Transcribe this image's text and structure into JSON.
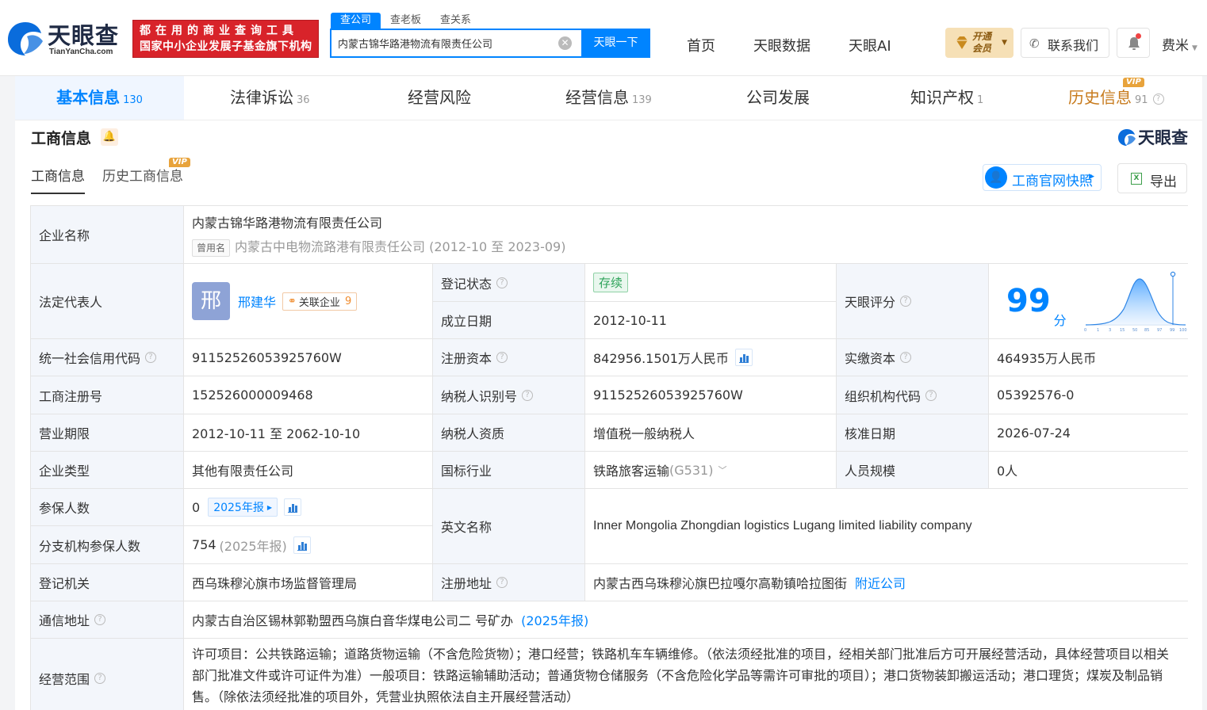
{
  "header": {
    "logo_text": "天眼查",
    "logo_sub": "TianYanCha.com",
    "slogan_line1": "都在用的商业查询工具",
    "slogan_line2": "国家中小企业发展子基金旗下机构",
    "search_tabs": [
      "查公司",
      "查老板",
      "查关系"
    ],
    "search_value": "内蒙古锦华路港物流有限责任公司",
    "search_button": "天眼一下",
    "nav": [
      "首页",
      "天眼数据",
      "天眼AI"
    ],
    "vip_line1": "开通",
    "vip_line2": "会员",
    "contact": "联系我们",
    "user": "费米"
  },
  "tabs": [
    {
      "label": "基本信息",
      "count": "130"
    },
    {
      "label": "法律诉讼",
      "count": "36"
    },
    {
      "label": "经营风险",
      "count": ""
    },
    {
      "label": "经营信息",
      "count": "139"
    },
    {
      "label": "公司发展",
      "count": ""
    },
    {
      "label": "知识产权",
      "count": "1"
    },
    {
      "label": "历史信息",
      "count": "91"
    }
  ],
  "vip_tag": "VIP",
  "section": {
    "title": "工商信息",
    "watermark": "天眼查",
    "subtabs": [
      "工商信息",
      "历史工商信息"
    ],
    "snapshot_button": "工商官网快照",
    "export_button": "导出"
  },
  "info": {
    "company_name_label": "企业名称",
    "company_name": "内蒙古锦华路港物流有限责任公司",
    "former_name_tag": "曾用名",
    "former_name": "内蒙古中电物流路港有限责任公司 (2012-10 至 2023-09)",
    "legal_rep_label": "法定代表人",
    "legal_rep_avatar": "邢",
    "legal_rep_name": "邢建华",
    "related_label": "关联企业",
    "related_count": "9",
    "reg_status_label": "登记状态",
    "reg_status": "存续",
    "founded_label": "成立日期",
    "founded": "2012-10-11",
    "score_label": "天眼评分",
    "score": "99",
    "score_unit": "分",
    "credit_code_label": "统一社会信用代码",
    "credit_code": "91152526053925760W",
    "reg_capital_label": "注册资本",
    "reg_capital": "842956.1501万人民币",
    "paid_capital_label": "实缴资本",
    "paid_capital": "464935万人民币",
    "reg_no_label": "工商注册号",
    "reg_no": "152526000009468",
    "taxpayer_id_label": "纳税人识别号",
    "taxpayer_id": "91152526053925760W",
    "org_code_label": "组织机构代码",
    "org_code": "05392576-0",
    "term_label": "营业期限",
    "term": "2012-10-11 至 2062-10-10",
    "tax_qual_label": "纳税人资质",
    "tax_qual": "增值税一般纳税人",
    "approval_label": "核准日期",
    "approval": "2026-07-24",
    "type_label": "企业类型",
    "type": "其他有限责任公司",
    "industry_label": "国标行业",
    "industry": "铁路旅客运输",
    "industry_code": "(G531)",
    "staff_label": "人员规模",
    "staff": "0人",
    "insured_label": "参保人数",
    "insured": "0",
    "insured_year": "2025年报",
    "branch_insured_label": "分支机构参保人数",
    "branch_insured": "754",
    "branch_insured_year": "(2025年报)",
    "english_label": "英文名称",
    "english": "Inner Mongolia Zhongdian logistics Lugang limited liability company",
    "authority_label": "登记机关",
    "authority": "西乌珠穆沁旗市场监督管理局",
    "address_label": "注册地址",
    "address": "内蒙古西乌珠穆沁旗巴拉嘎尔高勒镇哈拉图街",
    "nearby": "附近公司",
    "mail_label": "通信地址",
    "mail": "内蒙古自治区锡林郭勒盟西乌旗白音华煤电公司二 号矿办",
    "mail_year": "(2025年报)",
    "scope_label": "经营范围",
    "scope": "许可项目：公共铁路运输；道路货物运输（不含危险货物）；港口经营；铁路机车车辆维修。（依法须经批准的项目，经相关部门批准后方可开展经营活动，具体经营项目以相关部门批准文件或许可证件为准）一般项目：铁路运输辅助活动；普通货物仓储服务（不含危险化学品等需许可审批的项目）；港口货物装卸搬运活动；港口理货；煤炭及制品销售。（除依法须经批准的项目外，凭营业执照依法自主开展经营活动）"
  },
  "score_chart": {
    "ticks": [
      "0",
      "1",
      "3",
      "15",
      "50",
      "85",
      "97",
      "99",
      "100"
    ]
  },
  "colors": {
    "accent": "#0084ff",
    "slogan_red": "#d8232a",
    "vip_gold": "#c77a1c"
  }
}
